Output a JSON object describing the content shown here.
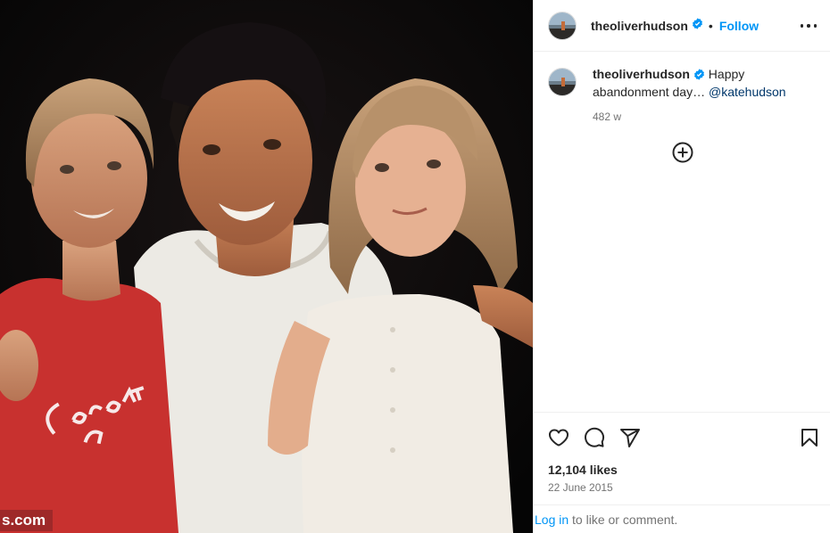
{
  "post": {
    "watermark": "s.com",
    "image_description_icon": "family-photo"
  },
  "header": {
    "username": "theoliverhudson",
    "separator": "•",
    "follow_label": "Follow"
  },
  "caption": {
    "username": "theoliverhudson",
    "text_pre": " Happy abandonment day… ",
    "mention": "@katehudson",
    "time_ago": "482 w"
  },
  "stats": {
    "likes": "12,104 likes",
    "date": "22 June 2015"
  },
  "login": {
    "link": "Log in",
    "rest": " to like or comment."
  },
  "colors": {
    "accent": "#0095f6",
    "verified": "#0095f6",
    "text": "#262626",
    "muted": "#737373"
  }
}
